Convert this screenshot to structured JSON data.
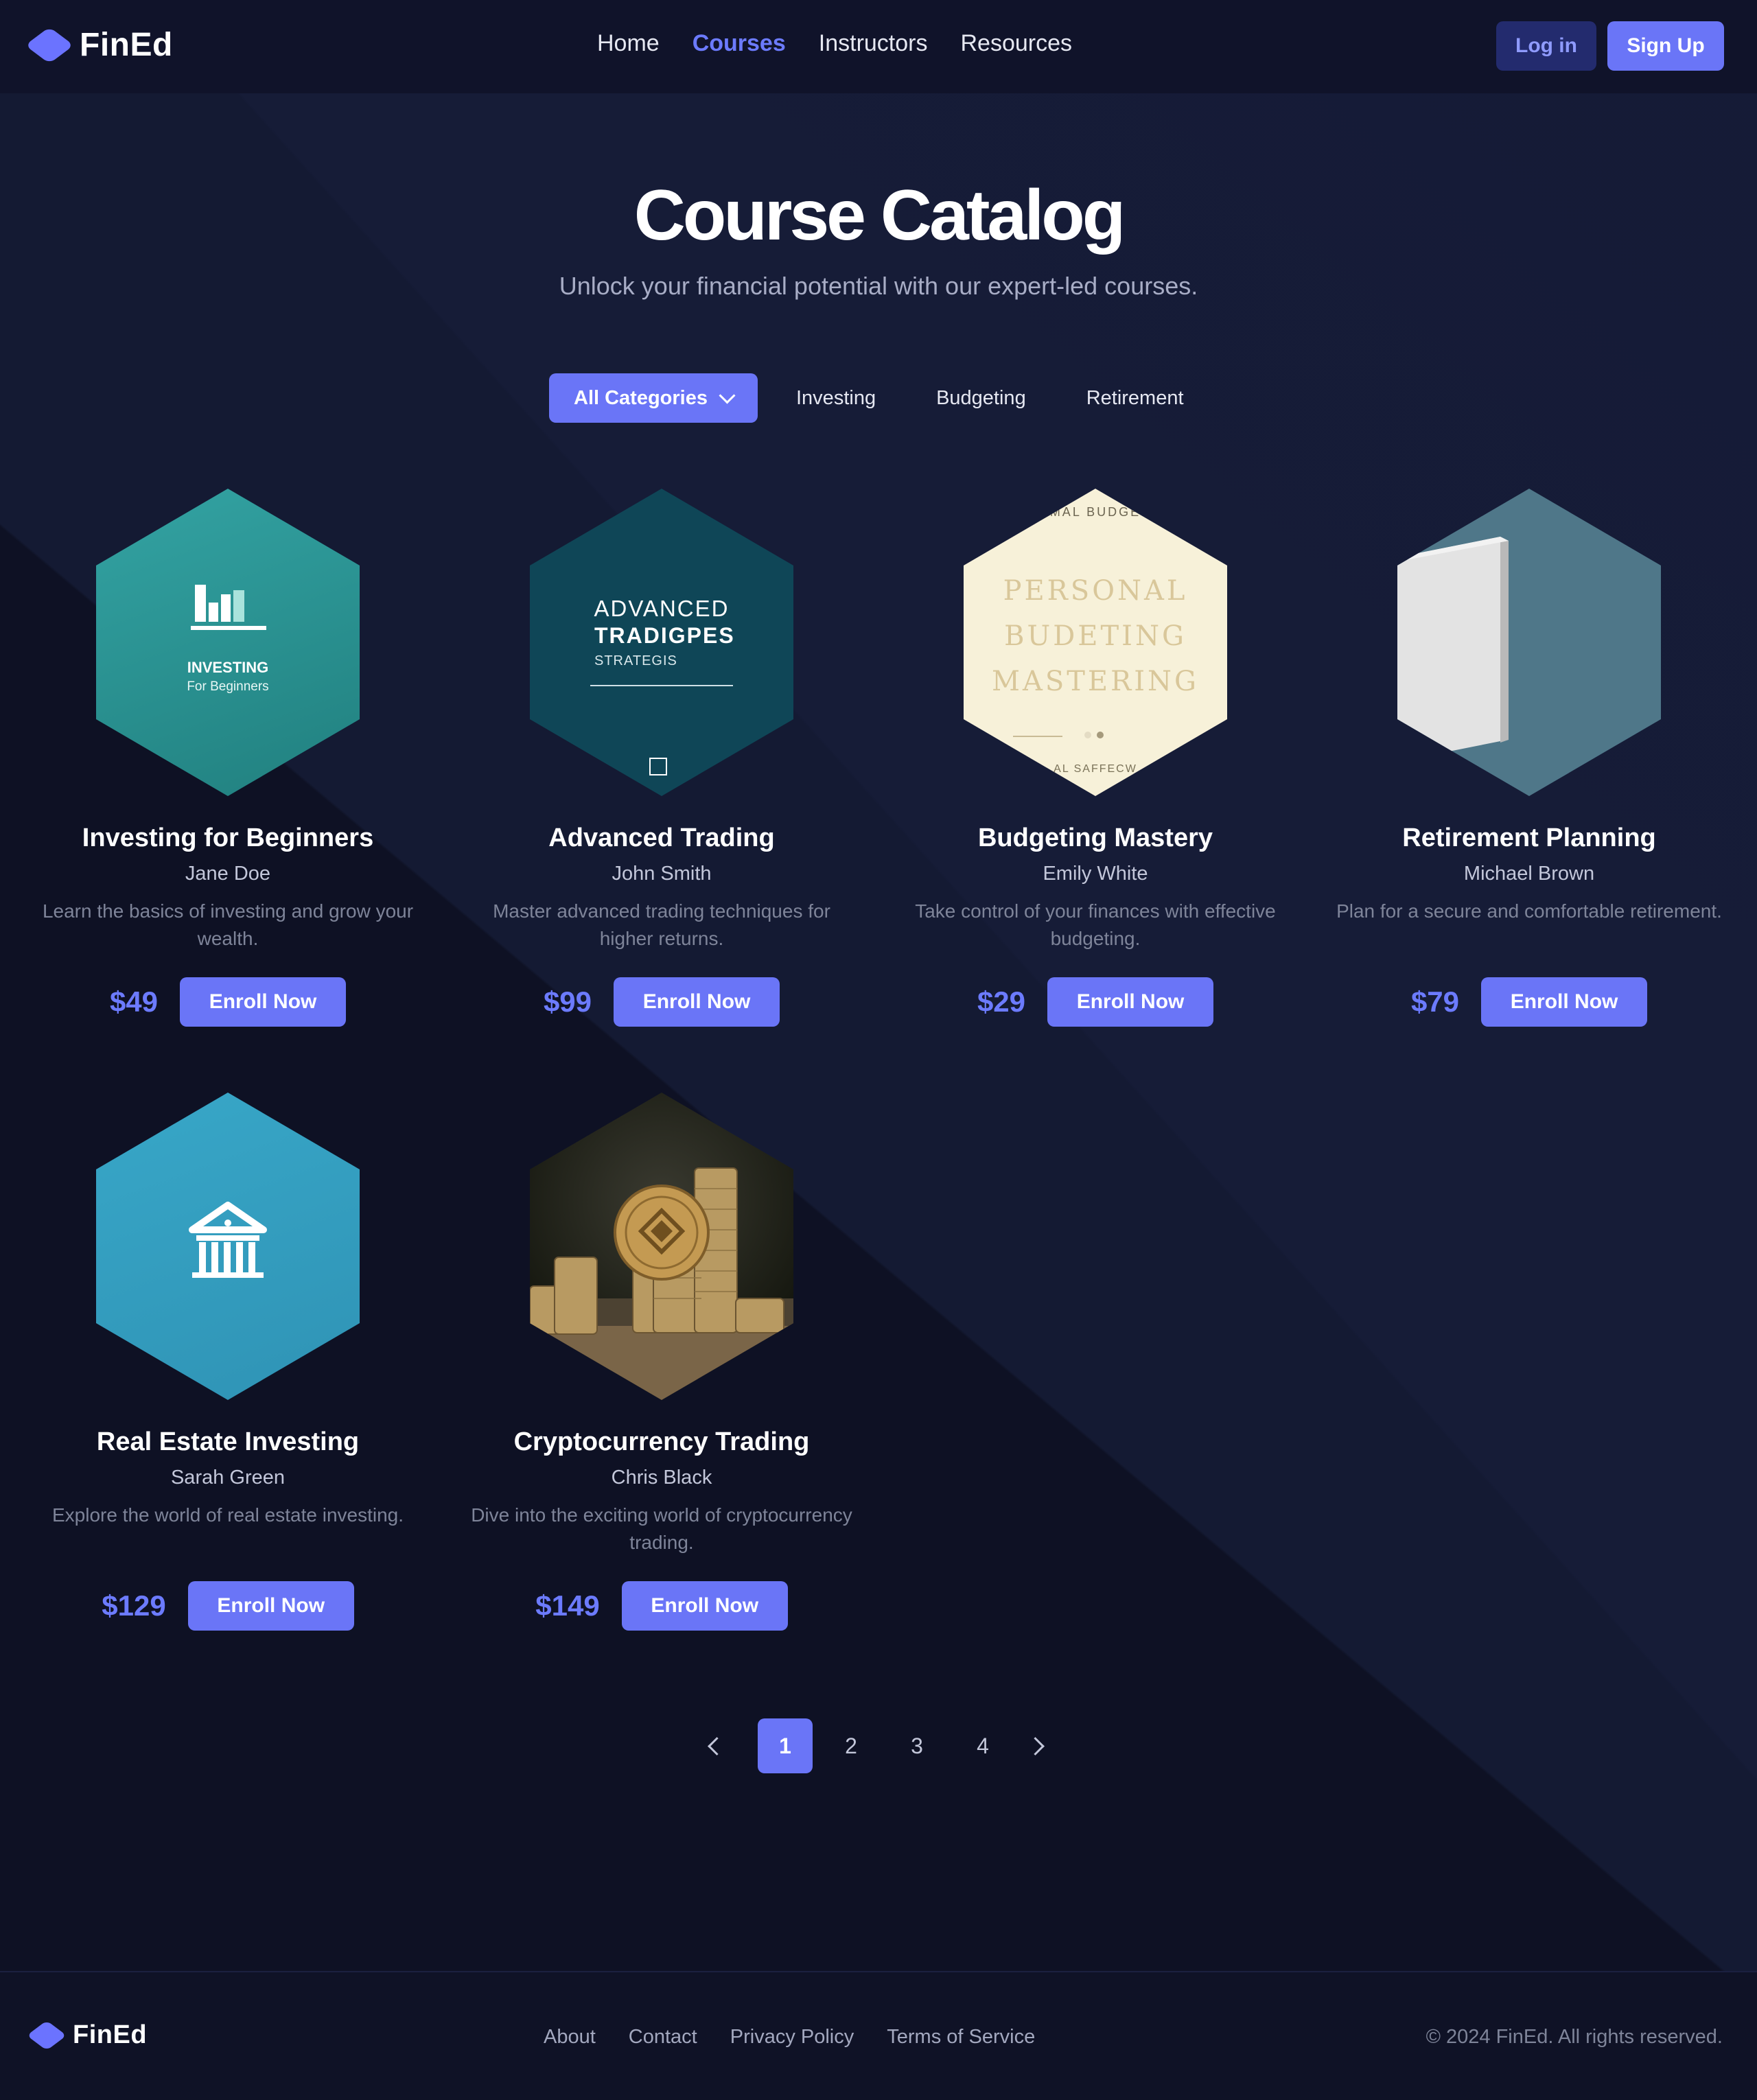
{
  "brand": {
    "name": "FinEd"
  },
  "nav": {
    "items": [
      {
        "label": "Home",
        "active": false
      },
      {
        "label": "Courses",
        "active": true
      },
      {
        "label": "Instructors",
        "active": false
      },
      {
        "label": "Resources",
        "active": false
      }
    ],
    "login_label": "Log in",
    "signup_label": "Sign Up"
  },
  "hero": {
    "title": "Course Catalog",
    "subtitle": "Unlock your financial potential with our expert-led courses."
  },
  "filters": {
    "active_label": "All Categories",
    "items": [
      "Investing",
      "Budgeting",
      "Retirement"
    ]
  },
  "cover_texts": {
    "investing_line1": "INVESTING",
    "investing_line2": "For Beginners",
    "advanced_line1": "ADVANCED",
    "advanced_line2": "TRADIGPES",
    "advanced_line3": "STRATEGIS",
    "budget_top": "MAL BUDGE",
    "budget_line1": "PERSONAL",
    "budget_line2": "BUDETING",
    "budget_line3": "MASTERING",
    "budget_bottom": "AL SAFFECW"
  },
  "courses": [
    {
      "title": "Investing for Beginners",
      "instructor": "Jane Doe",
      "description": "Learn the basics of investing and grow your wealth.",
      "price": "$49",
      "cta": "Enroll Now",
      "cover_color": "#2a9a9a",
      "icon": "bar-chart-icon"
    },
    {
      "title": "Advanced Trading",
      "instructor": "John Smith",
      "description": "Master advanced trading techniques for higher returns.",
      "price": "$99",
      "cta": "Enroll Now",
      "cover_color": "#0e4a5a",
      "icon": "square-icon"
    },
    {
      "title": "Budgeting Mastery",
      "instructor": "Emily White",
      "description": "Take control of your finances with effective budgeting.",
      "price": "$29",
      "cta": "Enroll Now",
      "cover_color": "#f6f1dc",
      "icon": "book-cover-icon"
    },
    {
      "title": "Retirement Planning",
      "instructor": "Michael Brown",
      "description": "Plan for a secure and comfortable retirement.",
      "price": "$79",
      "cta": "Enroll Now",
      "cover_color": "#4e7588",
      "icon": "blank-book-icon"
    },
    {
      "title": "Real Estate Investing",
      "instructor": "Sarah Green",
      "description": "Explore the world of real estate investing.",
      "price": "$129",
      "cta": "Enroll Now",
      "cover_color": "#36a0c2",
      "icon": "building-icon"
    },
    {
      "title": "Cryptocurrency Trading",
      "instructor": "Chris Black",
      "description": "Dive into the exciting world of cryptocurrency trading.",
      "price": "$149",
      "cta": "Enroll Now",
      "cover_color": "#2c2a20",
      "icon": "coin-stack-icon"
    }
  ],
  "pagination": {
    "pages": [
      "1",
      "2",
      "3",
      "4"
    ],
    "current": "1"
  },
  "footer": {
    "links": [
      "About",
      "Contact",
      "Privacy Policy",
      "Terms of Service"
    ],
    "copyright": "© 2024 FinEd. All rights reserved."
  },
  "colors": {
    "accent": "#6a75f7",
    "background": "#0e1124",
    "price": "#6c7bff"
  }
}
